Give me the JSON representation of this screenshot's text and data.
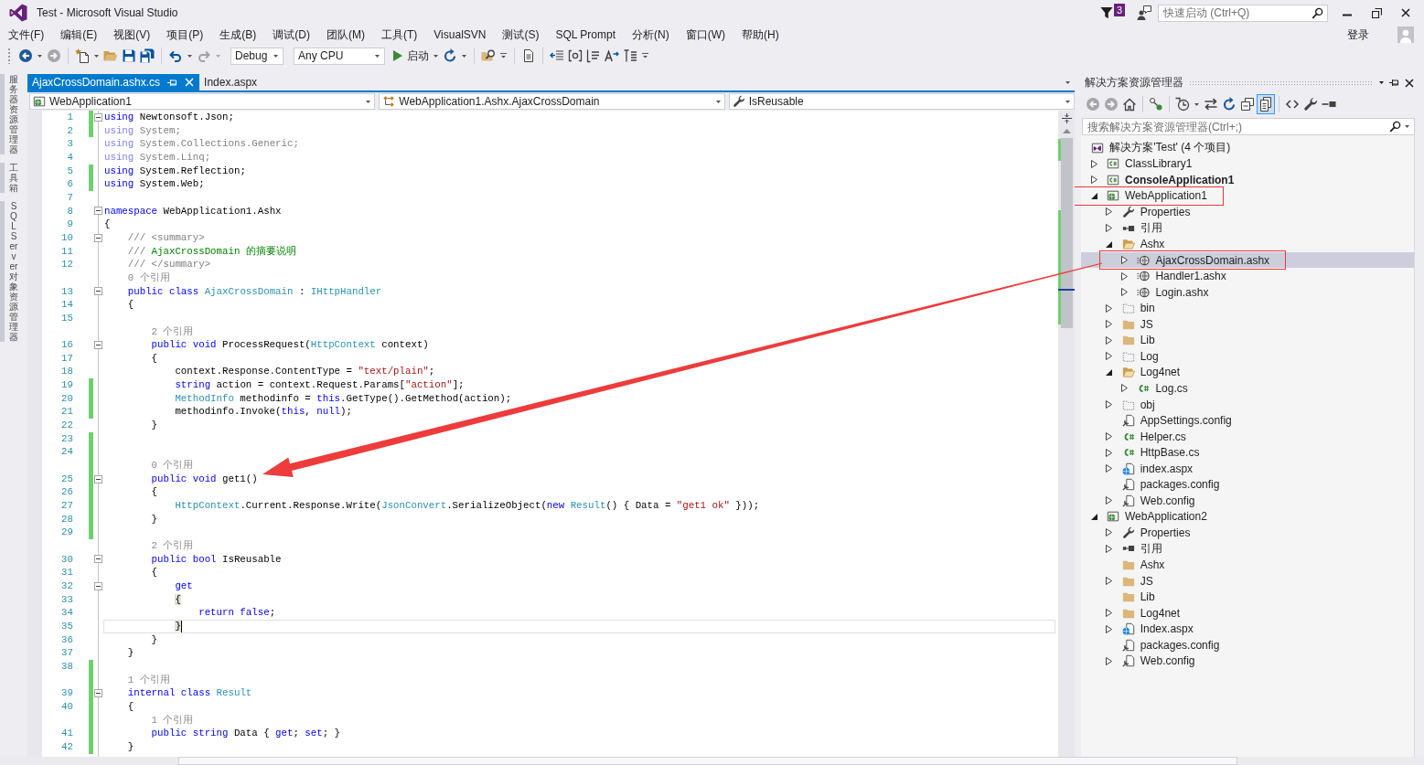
{
  "window": {
    "title": "Test - Microsoft Visual Studio",
    "notifications": "3",
    "quick_launch": {
      "placeholder": "快速启动 (Ctrl+Q)"
    }
  },
  "menu": {
    "items": [
      "文件(F)",
      "编辑(E)",
      "视图(V)",
      "项目(P)",
      "生成(B)",
      "调试(D)",
      "团队(M)",
      "工具(T)",
      "VisualSVN",
      "测试(S)",
      "SQL Prompt",
      "分析(N)",
      "窗口(W)",
      "帮助(H)"
    ],
    "sign_in": "登录"
  },
  "toolbar": [
    [
      {
        "kind": "back",
        "disabled": false
      },
      {
        "kind": "caret",
        "disabled": false
      },
      {
        "kind": "forward",
        "disabled": true
      }
    ],
    [
      {
        "kind": "new_project",
        "disabled": false
      },
      {
        "kind": "caret",
        "disabled": false
      },
      {
        "kind": "open",
        "disabled": false
      },
      {
        "kind": "save",
        "disabled": false
      },
      {
        "kind": "save_all",
        "disabled": false
      }
    ],
    [
      {
        "kind": "undo",
        "disabled": false
      },
      {
        "kind": "caret",
        "disabled": false
      },
      {
        "kind": "redo",
        "disabled": true
      },
      {
        "kind": "caret",
        "disabled": true
      },
      {
        "kind": "combo",
        "value": "Debug",
        "disabled": false
      },
      {
        "kind": "combo",
        "value": "Any CPU",
        "disabled": false
      },
      {
        "kind": "start",
        "label": "启动",
        "disabled": false
      },
      {
        "kind": "caret",
        "disabled": false
      },
      {
        "kind": "refresh",
        "disabled": false
      },
      {
        "kind": "caret",
        "disabled": false
      }
    ],
    [
      {
        "kind": "find",
        "disabled": false
      },
      {
        "kind": "overflow",
        "disabled": false
      }
    ],
    [
      {
        "kind": "document",
        "disabled": false
      }
    ],
    [
      {
        "kind": "indent",
        "disabled": false
      },
      {
        "kind": "brackets",
        "disabled": false
      },
      {
        "kind": "list",
        "disabled": false
      },
      {
        "kind": "text_arrow",
        "disabled": false
      },
      {
        "kind": "columns",
        "disabled": false
      },
      {
        "kind": "overflow",
        "disabled": false
      }
    ]
  ],
  "side_tabs": [
    "服务器资源管理器",
    "工具箱",
    "SQL Server 对象资源管理器"
  ],
  "document_tabs": [
    {
      "label": "AjaxCrossDomain.ashx.cs",
      "selected": true
    },
    {
      "label": "Index.aspx",
      "selected": false
    }
  ],
  "navigation_bar": [
    {
      "kind": "project",
      "value": "WebApplication1"
    },
    {
      "kind": "class",
      "value": "WebApplication1.Ashx.AjaxCrossDomain"
    },
    {
      "kind": "member",
      "value": "IsReusable"
    }
  ],
  "editor": {
    "lines": [
      {
        "kind": "code",
        "n": "1",
        "changed": true,
        "fold": true,
        "current": false,
        "tokens": [
          {
            "kind": "kw",
            "text": "using"
          },
          {
            "kind": "txt",
            "text": " Newtonsoft.Json;"
          }
        ]
      },
      {
        "kind": "code",
        "n": "2",
        "changed": true,
        "fold": false,
        "current": false,
        "tokens": [
          {
            "kind": "dimkw",
            "text": "using"
          },
          {
            "kind": "dim",
            "text": " System;"
          }
        ]
      },
      {
        "kind": "code",
        "n": "3",
        "changed": false,
        "fold": false,
        "current": false,
        "tokens": [
          {
            "kind": "dimkw",
            "text": "using"
          },
          {
            "kind": "dim",
            "text": " System.Collections.Generic;"
          }
        ]
      },
      {
        "kind": "code",
        "n": "4",
        "changed": false,
        "fold": false,
        "current": false,
        "tokens": [
          {
            "kind": "dimkw",
            "text": "using"
          },
          {
            "kind": "dim",
            "text": " System.Linq;"
          }
        ]
      },
      {
        "kind": "code",
        "n": "5",
        "changed": true,
        "fold": false,
        "current": false,
        "tokens": [
          {
            "kind": "kw",
            "text": "using"
          },
          {
            "kind": "txt",
            "text": " System.Reflection;"
          }
        ]
      },
      {
        "kind": "code",
        "n": "6",
        "changed": true,
        "fold": false,
        "current": false,
        "tokens": [
          {
            "kind": "kw",
            "text": "using"
          },
          {
            "kind": "txt",
            "text": " System.Web;"
          }
        ]
      },
      {
        "kind": "code",
        "n": "7",
        "changed": false,
        "fold": false,
        "current": false
      },
      {
        "kind": "code",
        "n": "8",
        "changed": false,
        "fold": true,
        "current": false,
        "tokens": [
          {
            "kind": "kw",
            "text": "namespace"
          },
          {
            "kind": "txt",
            "text": " WebApplication1.Ashx"
          }
        ]
      },
      {
        "kind": "code",
        "n": "9",
        "changed": false,
        "fold": false,
        "current": false,
        "tokens": [
          {
            "kind": "txt",
            "text": "{"
          }
        ],
        "children": [
          {
            "kind": "code",
            "n": "10",
            "changed": false,
            "fold": true,
            "current": false,
            "tokens": [
              {
                "kind": "doc",
                "text": "/// <summary>"
              }
            ]
          },
          {
            "kind": "code",
            "n": "11",
            "changed": false,
            "fold": false,
            "current": false,
            "tokens": [
              {
                "kind": "doc",
                "text": "/// "
              },
              {
                "kind": "com",
                "text": "AjaxCrossDomain 的摘要说明"
              }
            ]
          },
          {
            "kind": "code",
            "n": "12",
            "changed": false,
            "fold": false,
            "current": false,
            "tokens": [
              {
                "kind": "doc",
                "text": "/// </summary>"
              }
            ]
          },
          {
            "kind": "lens",
            "changed": false,
            "text": "0 个引用"
          },
          {
            "kind": "code",
            "n": "13",
            "changed": false,
            "fold": true,
            "current": false,
            "tokens": [
              {
                "kind": "kw",
                "text": "public class "
              },
              {
                "kind": "type",
                "text": "AjaxCrossDomain"
              },
              {
                "kind": "txt",
                "text": " : "
              },
              {
                "kind": "type",
                "text": "IHttpHandler"
              }
            ]
          },
          {
            "kind": "code",
            "n": "14",
            "changed": false,
            "fold": false,
            "current": false,
            "tokens": [
              {
                "kind": "txt",
                "text": "{"
              }
            ],
            "children": [
              {
                "kind": "code",
                "n": "15",
                "changed": false,
                "fold": false,
                "current": false
              },
              {
                "kind": "lens",
                "changed": false,
                "text": "2 个引用"
              },
              {
                "kind": "code",
                "n": "16",
                "changed": false,
                "fold": true,
                "current": false,
                "tokens": [
                  {
                    "kind": "kw",
                    "text": "public void"
                  },
                  {
                    "kind": "txt",
                    "text": " ProcessRequest("
                  },
                  {
                    "kind": "type",
                    "text": "HttpContext"
                  },
                  {
                    "kind": "txt",
                    "text": " context)"
                  }
                ]
              },
              {
                "kind": "code",
                "n": "17",
                "changed": false,
                "fold": false,
                "current": false,
                "tokens": [
                  {
                    "kind": "txt",
                    "text": "{"
                  }
                ],
                "children": [
                  {
                    "kind": "code",
                    "n": "18",
                    "changed": false,
                    "fold": false,
                    "current": false,
                    "tokens": [
                      {
                        "kind": "txt",
                        "text": "context.Response.ContentType = "
                      },
                      {
                        "kind": "str",
                        "text": "\"text/plain\""
                      },
                      {
                        "kind": "txt",
                        "text": ";"
                      }
                    ]
                  },
                  {
                    "kind": "code",
                    "n": "19",
                    "changed": true,
                    "fold": false,
                    "current": false,
                    "tokens": [
                      {
                        "kind": "kw",
                        "text": "string"
                      },
                      {
                        "kind": "txt",
                        "text": " action = context.Request.Params["
                      },
                      {
                        "kind": "str",
                        "text": "\"action\""
                      },
                      {
                        "kind": "txt",
                        "text": "];"
                      }
                    ]
                  },
                  {
                    "kind": "code",
                    "n": "20",
                    "changed": true,
                    "fold": false,
                    "current": false,
                    "tokens": [
                      {
                        "kind": "type",
                        "text": "MethodInfo"
                      },
                      {
                        "kind": "txt",
                        "text": " methodinfo = "
                      },
                      {
                        "kind": "kw",
                        "text": "this"
                      },
                      {
                        "kind": "txt",
                        "text": ".GetType().GetMethod(action);"
                      }
                    ]
                  },
                  {
                    "kind": "code",
                    "n": "21",
                    "changed": true,
                    "fold": false,
                    "current": false,
                    "tokens": [
                      {
                        "kind": "txt",
                        "text": "methodinfo.Invoke("
                      },
                      {
                        "kind": "kw",
                        "text": "this"
                      },
                      {
                        "kind": "txt",
                        "text": ", "
                      },
                      {
                        "kind": "kw",
                        "text": "null"
                      },
                      {
                        "kind": "txt",
                        "text": ");"
                      }
                    ]
                  }
                ]
              },
              {
                "kind": "code",
                "n": "22",
                "changed": false,
                "fold": false,
                "current": false,
                "tokens": [
                  {
                    "kind": "txt",
                    "text": "}"
                  }
                ]
              },
              {
                "kind": "code",
                "n": "23",
                "changed": true,
                "fold": false,
                "current": false
              },
              {
                "kind": "code",
                "n": "24",
                "changed": true,
                "fold": false,
                "current": false
              },
              {
                "kind": "lens",
                "changed": true,
                "text": "0 个引用"
              },
              {
                "kind": "code",
                "n": "25",
                "changed": true,
                "fold": true,
                "current": false,
                "tokens": [
                  {
                    "kind": "kw",
                    "text": "public void"
                  },
                  {
                    "kind": "txt",
                    "text": " get1()"
                  }
                ]
              },
              {
                "kind": "code",
                "n": "26",
                "changed": true,
                "fold": false,
                "current": false,
                "tokens": [
                  {
                    "kind": "txt",
                    "text": "{"
                  }
                ],
                "children": [
                  {
                    "kind": "code",
                    "n": "27",
                    "changed": true,
                    "fold": false,
                    "current": false,
                    "tokens": [
                      {
                        "kind": "type",
                        "text": "HttpContext"
                      },
                      {
                        "kind": "txt",
                        "text": ".Current.Response.Write("
                      },
                      {
                        "kind": "type",
                        "text": "JsonConvert"
                      },
                      {
                        "kind": "txt",
                        "text": ".SerializeObject("
                      },
                      {
                        "kind": "kw",
                        "text": "new "
                      },
                      {
                        "kind": "type",
                        "text": "Result"
                      },
                      {
                        "kind": "txt",
                        "text": "() { Data = "
                      },
                      {
                        "kind": "str",
                        "text": "\"get1 ok\""
                      },
                      {
                        "kind": "txt",
                        "text": " }));"
                      }
                    ]
                  }
                ]
              },
              {
                "kind": "code",
                "n": "28",
                "changed": true,
                "fold": false,
                "current": false,
                "tokens": [
                  {
                    "kind": "txt",
                    "text": "}"
                  }
                ]
              },
              {
                "kind": "code",
                "n": "29",
                "changed": true,
                "fold": false,
                "current": false
              },
              {
                "kind": "lens",
                "changed": false,
                "text": "2 个引用"
              },
              {
                "kind": "code",
                "n": "30",
                "changed": false,
                "fold": true,
                "current": false,
                "tokens": [
                  {
                    "kind": "kw",
                    "text": "public bool"
                  },
                  {
                    "kind": "txt",
                    "text": " IsReusable"
                  }
                ]
              },
              {
                "kind": "code",
                "n": "31",
                "changed": false,
                "fold": false,
                "current": false,
                "tokens": [
                  {
                    "kind": "txt",
                    "text": "{"
                  }
                ],
                "children": [
                  {
                    "kind": "code",
                    "n": "32",
                    "changed": false,
                    "fold": true,
                    "current": false,
                    "tokens": [
                      {
                        "kind": "kw",
                        "text": "get"
                      }
                    ]
                  },
                  {
                    "kind": "code",
                    "n": "33",
                    "changed": false,
                    "fold": false,
                    "current": false,
                    "tokens": [
                      {
                        "kind": "brace",
                        "text": "{"
                      }
                    ],
                    "children": [
                      {
                        "kind": "code",
                        "n": "34",
                        "changed": false,
                        "fold": false,
                        "current": false,
                        "tokens": [
                          {
                            "kind": "kw",
                            "text": "return false"
                          },
                          {
                            "kind": "txt",
                            "text": ";"
                          }
                        ]
                      }
                    ]
                  },
                  {
                    "kind": "code",
                    "n": "35",
                    "changed": false,
                    "fold": false,
                    "current": true,
                    "tokens": [
                      {
                        "kind": "brace",
                        "text": "}"
                      }
                    ]
                  }
                ]
              },
              {
                "kind": "code",
                "n": "36",
                "changed": false,
                "fold": false,
                "current": false,
                "tokens": [
                  {
                    "kind": "txt",
                    "text": "}"
                  }
                ]
              }
            ]
          },
          {
            "kind": "code",
            "n": "37",
            "changed": false,
            "fold": false,
            "current": false,
            "tokens": [
              {
                "kind": "txt",
                "text": "}"
              }
            ]
          },
          {
            "kind": "code",
            "n": "38",
            "changed": true,
            "fold": false,
            "current": false
          },
          {
            "kind": "lens",
            "changed": true,
            "text": "1 个引用"
          },
          {
            "kind": "code",
            "n": "39",
            "changed": true,
            "fold": true,
            "current": false,
            "tokens": [
              {
                "kind": "kw",
                "text": "internal class "
              },
              {
                "kind": "type",
                "text": "Result"
              }
            ]
          },
          {
            "kind": "code",
            "n": "40",
            "changed": true,
            "fold": false,
            "current": false,
            "tokens": [
              {
                "kind": "txt",
                "text": "{"
              }
            ],
            "children": [
              {
                "kind": "lens",
                "changed": true,
                "text": "1 个引用"
              },
              {
                "kind": "code",
                "n": "41",
                "changed": true,
                "fold": false,
                "current": false,
                "tokens": [
                  {
                    "kind": "kw",
                    "text": "public string"
                  },
                  {
                    "kind": "txt",
                    "text": " Data { "
                  },
                  {
                    "kind": "kw",
                    "text": "get"
                  },
                  {
                    "kind": "txt",
                    "text": "; "
                  },
                  {
                    "kind": "kw",
                    "text": "set"
                  },
                  {
                    "kind": "txt",
                    "text": "; }"
                  }
                ]
              }
            ]
          },
          {
            "kind": "code",
            "n": "42",
            "changed": true,
            "fold": false,
            "current": false,
            "tokens": [
              {
                "kind": "txt",
                "text": "}"
              }
            ]
          }
        ]
      }
    ]
  },
  "solution_explorer": {
    "title": "解决方案资源管理器",
    "toolbar": [
      [
        {
          "kind": "back",
          "disabled": true,
          "on": false
        },
        {
          "kind": "forward",
          "disabled": true,
          "on": false
        },
        {
          "kind": "home",
          "disabled": false,
          "on": false
        }
      ],
      [
        {
          "kind": "pending",
          "disabled": false,
          "on": false
        }
      ],
      [
        {
          "kind": "history",
          "disabled": false,
          "on": false
        },
        {
          "kind": "caret",
          "disabled": false,
          "on": false
        },
        {
          "kind": "sync",
          "disabled": false,
          "on": false
        },
        {
          "kind": "refresh",
          "disabled": false,
          "on": false
        },
        {
          "kind": "collapse",
          "disabled": false,
          "on": false
        },
        {
          "kind": "show_all",
          "disabled": false,
          "on": true
        }
      ],
      [
        {
          "kind": "code_view",
          "disabled": false,
          "on": false
        },
        {
          "kind": "properties",
          "disabled": false,
          "on": false
        },
        {
          "kind": "preview",
          "disabled": false,
          "on": false
        }
      ]
    ],
    "search": {
      "placeholder": "搜索解决方案资源管理器(Ctrl+;)"
    },
    "tree": [
      {
        "label": "解决方案'Test' (4 个项目)",
        "kind": "solution",
        "selected": false,
        "annotated": false,
        "children": [
          {
            "label": "ClassLibrary1",
            "kind": "cs_project",
            "expanded": false,
            "selected": false,
            "annotated": false,
            "startup": false
          },
          {
            "label": "ConsoleApplication1",
            "kind": "cs_project",
            "expanded": false,
            "selected": false,
            "annotated": false,
            "startup": true
          },
          {
            "label": "WebApplication1",
            "kind": "web_project",
            "expanded": true,
            "selected": false,
            "annotated": true,
            "startup": false,
            "children": [
              {
                "label": "Properties",
                "kind": "properties",
                "expanded": false,
                "selected": false,
                "annotated": false
              },
              {
                "label": "引用",
                "kind": "references",
                "expanded": false,
                "selected": false,
                "annotated": false
              },
              {
                "label": "Ashx",
                "kind": "folder_open",
                "expanded": true,
                "selected": false,
                "annotated": false,
                "children": [
                  {
                    "label": "AjaxCrossDomain.ashx",
                    "kind": "handler",
                    "expanded": false,
                    "selected": true,
                    "annotated": true
                  },
                  {
                    "label": "Handler1.ashx",
                    "kind": "handler",
                    "expanded": false,
                    "selected": false,
                    "annotated": false
                  },
                  {
                    "label": "Login.ashx",
                    "kind": "handler",
                    "expanded": false,
                    "selected": false,
                    "annotated": false
                  }
                ]
              },
              {
                "label": "bin",
                "kind": "folder_hidden",
                "expanded": false,
                "selected": false,
                "annotated": false
              },
              {
                "label": "JS",
                "kind": "folder",
                "expanded": false,
                "selected": false,
                "annotated": false
              },
              {
                "label": "Lib",
                "kind": "folder",
                "expanded": false,
                "selected": false,
                "annotated": false
              },
              {
                "label": "Log",
                "kind": "folder_hidden",
                "expanded": false,
                "selected": false,
                "annotated": false
              },
              {
                "label": "Log4net",
                "kind": "folder_open",
                "expanded": true,
                "selected": false,
                "annotated": false,
                "children": [
                  {
                    "label": "Log.cs",
                    "kind": "cs_file",
                    "expanded": false,
                    "selected": false,
                    "annotated": false
                  }
                ]
              },
              {
                "label": "obj",
                "kind": "folder_hidden",
                "expanded": false,
                "selected": false,
                "annotated": false
              },
              {
                "label": "AppSettings.config",
                "kind": "config",
                "selected": false,
                "annotated": false
              },
              {
                "label": "Helper.cs",
                "kind": "cs_file",
                "expanded": false,
                "selected": false,
                "annotated": false
              },
              {
                "label": "HttpBase.cs",
                "kind": "cs_file",
                "expanded": false,
                "selected": false,
                "annotated": false
              },
              {
                "label": "index.aspx",
                "kind": "web_page",
                "expanded": false,
                "selected": false,
                "annotated": false
              },
              {
                "label": "packages.config",
                "kind": "config",
                "selected": false,
                "annotated": false
              },
              {
                "label": "Web.config",
                "kind": "config",
                "expanded": false,
                "selected": false,
                "annotated": false
              }
            ]
          },
          {
            "label": "WebApplication2",
            "kind": "web_project",
            "expanded": true,
            "selected": false,
            "annotated": false,
            "startup": false,
            "children": [
              {
                "label": "Properties",
                "kind": "properties",
                "expanded": false,
                "selected": false,
                "annotated": false
              },
              {
                "label": "引用",
                "kind": "references",
                "expanded": false,
                "selected": false,
                "annotated": false
              },
              {
                "label": "Ashx",
                "kind": "folder",
                "selected": false,
                "annotated": false
              },
              {
                "label": "JS",
                "kind": "folder",
                "expanded": false,
                "selected": false,
                "annotated": false
              },
              {
                "label": "Lib",
                "kind": "folder",
                "selected": false,
                "annotated": false
              },
              {
                "label": "Log4net",
                "kind": "folder",
                "expanded": false,
                "selected": false,
                "annotated": false
              },
              {
                "label": "Index.aspx",
                "kind": "web_page",
                "expanded": false,
                "selected": false,
                "annotated": false
              },
              {
                "label": "packages.config",
                "kind": "config",
                "selected": false,
                "annotated": false
              },
              {
                "label": "Web.config",
                "kind": "config",
                "expanded": false,
                "selected": false,
                "annotated": false
              }
            ]
          }
        ]
      }
    ]
  }
}
